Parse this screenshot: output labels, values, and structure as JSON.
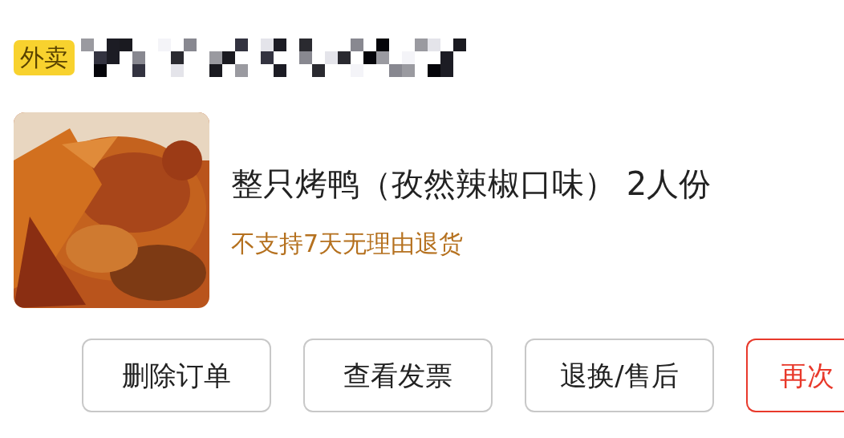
{
  "tag": "外卖",
  "item": {
    "title": "整只烤鸭（孜然辣椒口味） 2人份",
    "note": "不支持7天无理由退货"
  },
  "buttons": [
    {
      "label": "删除订单",
      "kind": "plain"
    },
    {
      "label": "查看发票",
      "kind": "plain"
    },
    {
      "label": "退换/售后",
      "kind": "plain"
    },
    {
      "label": "再次",
      "kind": "primary"
    }
  ]
}
